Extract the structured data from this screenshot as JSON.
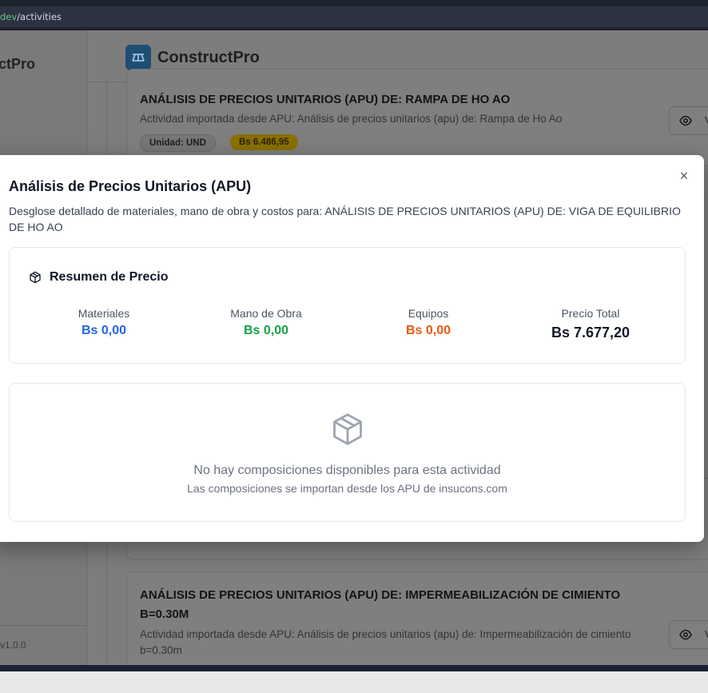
{
  "browser": {
    "url_host": "dev",
    "url_path": "/activities"
  },
  "sidebar": {
    "brand": "ctPro",
    "version": "v1.0.0"
  },
  "header": {
    "brand": "ConstructPro"
  },
  "cards": [
    {
      "title": "ANÁLISIS DE PRECIOS UNITARIOS (APU) DE: RAMPA DE HO AO",
      "description": "Actividad importada desde APU: Análisis de precios unitarios (apu) de: Rampa de Ho Ao",
      "unit": "Unidad: UND",
      "price": "Bs 6.486,95",
      "view_label": "V"
    },
    {
      "title_line1": "ANÁLISIS DE PRECIOS UNITARIOS (APU) DE: IMPERMEABILIZACIÓN DE CIMIENTO",
      "title_line2": "B=0.30M",
      "description_line1": "Actividad importada desde APU: Análisis de precios unitarios (apu) de: Impermeabilización de cimiento",
      "description_line2": "b=0.30m",
      "view_label": "V"
    }
  ],
  "modal": {
    "title": "Análisis de Precios Unitarios (APU)",
    "description": "Desglose detallado de materiales, mano de obra y costos para: ANÁLISIS DE PRECIOS UNITARIOS (APU) DE: VIGA DE EQUILIBRIO DE HO AO",
    "close": "×",
    "summary": {
      "heading": "Resumen de Precio",
      "materials_label": "Materiales",
      "materials_value": "Bs 0,00",
      "labor_label": "Mano de Obra",
      "labor_value": "Bs 0,00",
      "equipment_label": "Equipos",
      "equipment_value": "Bs 0,00",
      "total_label": "Precio Total",
      "total_value": "Bs 7.677,20"
    },
    "empty": {
      "message": "No hay composiciones disponibles para esta actividad",
      "hint": "Las composiciones se importan desde los APU de insucons.com"
    }
  },
  "colors": {
    "materials": "#2563eb",
    "labor": "#16a34a",
    "equipment": "#ea580c",
    "price_chip": "#facc15"
  }
}
